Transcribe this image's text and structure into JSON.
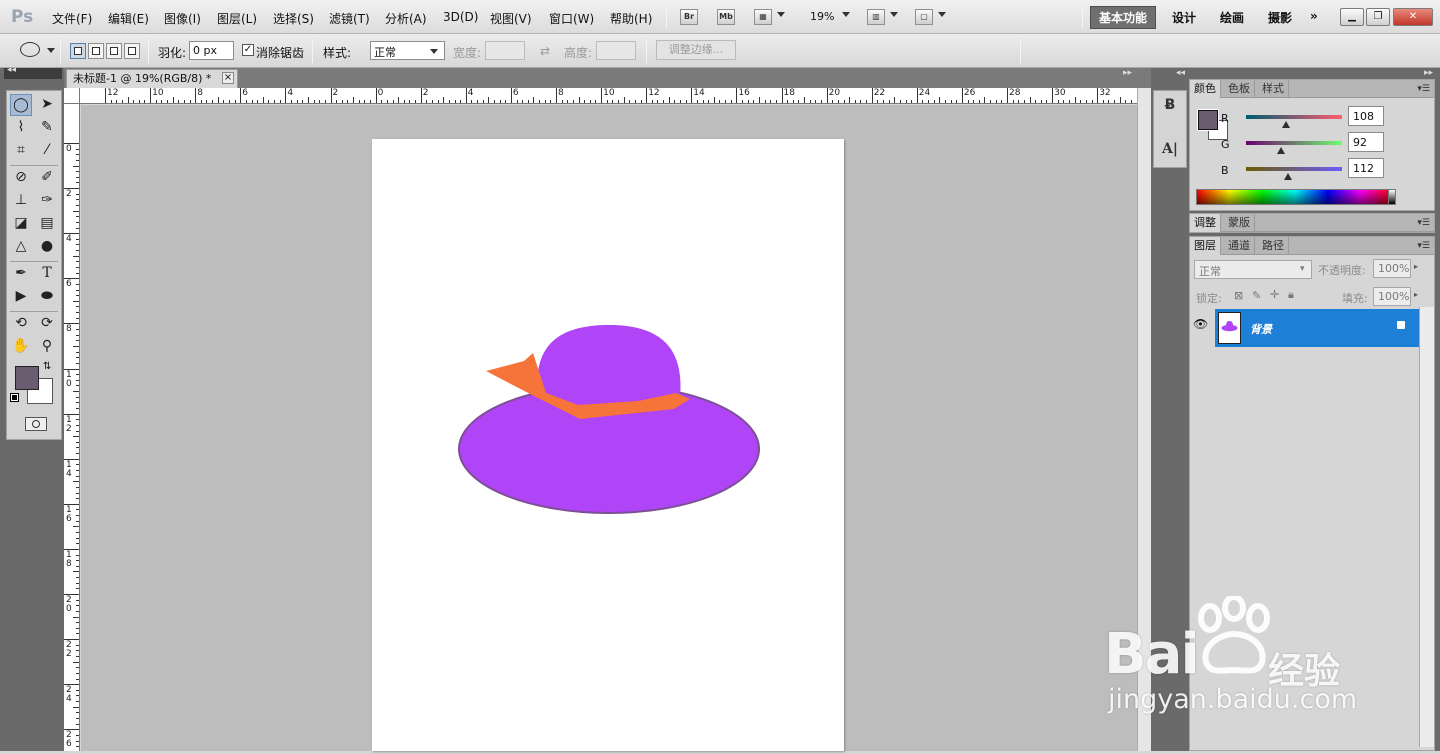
{
  "app": {
    "logo": "Ps"
  },
  "menu": [
    "文件(F)",
    "编辑(E)",
    "图像(I)",
    "图层(L)",
    "选择(S)",
    "滤镜(T)",
    "分析(A)",
    "3D(D)",
    "视图(V)",
    "窗口(W)",
    "帮助(H)"
  ],
  "app_bar": {
    "bridge": "Br",
    "mini_bridge": "Mb",
    "zoom": "19%"
  },
  "workspaces": [
    "基本功能",
    "设计",
    "绘画",
    "摄影",
    "»"
  ],
  "options": {
    "feather_label": "羽化:",
    "feather_value": "0 px",
    "antialias_label": "消除锯齿",
    "antialias_checked": true,
    "style_label": "样式:",
    "style_value": "正常",
    "width_label": "宽度:",
    "height_label": "高度:",
    "refine_edge": "调整边缘..."
  },
  "document": {
    "tab_title": "未标题-1 @ 19%(RGB/8) *",
    "close": "×",
    "ruler_h": [
      "12",
      "10",
      "8",
      "6",
      "4",
      "2",
      "0",
      "2",
      "4",
      "6",
      "8",
      "10",
      "12",
      "14",
      "16",
      "18",
      "20",
      "22",
      "24",
      "26",
      "28",
      "30",
      "32"
    ],
    "ruler_v": [
      "0",
      "2",
      "4",
      "6",
      "8",
      "10",
      "12",
      "14",
      "16",
      "18",
      "20",
      "22",
      "24",
      "26"
    ]
  },
  "tools": {
    "fg_color": "#6c5c70",
    "bg_color": "#ffffff"
  },
  "color_panel": {
    "tabs": [
      "颜色",
      "色板",
      "样式"
    ],
    "r_label": "R",
    "r_value": "108",
    "g_label": "G",
    "g_value": "92",
    "b_label": "B",
    "b_value": "112",
    "r_fraction": 0.42,
    "g_fraction": 0.36,
    "b_fraction": 0.44
  },
  "adjust_panel": {
    "tabs": [
      "调整",
      "蒙版"
    ]
  },
  "layers_panel": {
    "tabs": [
      "图层",
      "通道",
      "路径"
    ],
    "blend_mode": "正常",
    "opacity_label": "不透明度:",
    "opacity_value": "100%",
    "lock_label": "锁定:",
    "fill_label": "填充:",
    "fill_value": "100%",
    "layer_name": "背景"
  },
  "canvas_art": {
    "brim_color": "#b044f7",
    "crown_color": "#b044f7",
    "ribbon_color": "#f6733a",
    "outline_color": "#7d4f96"
  },
  "watermark": {
    "brand_text": "Bai",
    "brand_cn": "经验",
    "url": "jingyan.baidu.com"
  }
}
